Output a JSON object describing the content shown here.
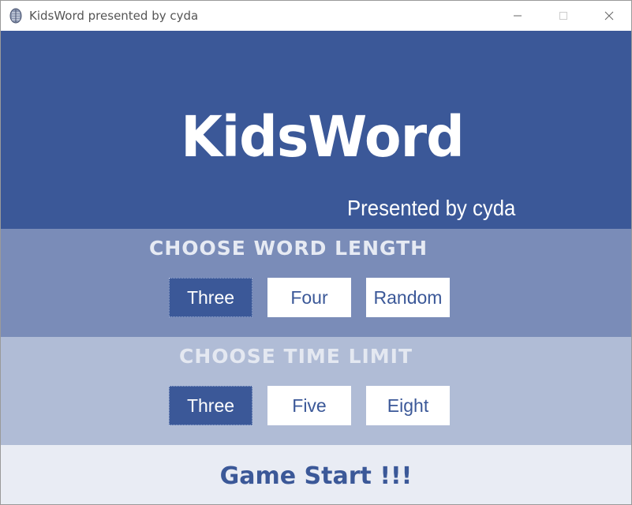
{
  "window": {
    "title": "KidsWord presented by cyda",
    "minimize_glyph": "—",
    "maximize_glyph": "☐",
    "close_glyph": "✕"
  },
  "header": {
    "title": "KidsWord",
    "subtitle": "Presented by cyda"
  },
  "word_length": {
    "heading": "CHOOSE WORD LENGTH",
    "options": [
      "Three",
      "Four",
      "Random"
    ],
    "selected": "Three"
  },
  "time_limit": {
    "heading": "CHOOSE TIME LIMIT",
    "options": [
      "Three",
      "Five",
      "Eight"
    ],
    "selected": "Three"
  },
  "footer": {
    "start_label": "Game Start !!!"
  },
  "colors": {
    "primary": "#3b5898",
    "length_band": "#7a8cb8",
    "time_band": "#b0bcd6",
    "footer_band": "#e9ecf4"
  },
  "icons": {
    "app": "feather-app-icon"
  }
}
